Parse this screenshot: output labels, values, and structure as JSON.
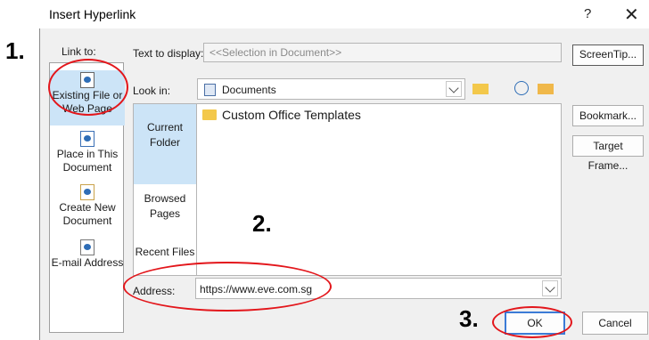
{
  "window": {
    "title": "Insert Hyperlink",
    "help": "?",
    "close": "✕"
  },
  "link_to": {
    "label": "Link to:",
    "items": [
      {
        "line1": "Existing File or",
        "line2": "Web Page",
        "selected": true
      },
      {
        "line1": "Place in This",
        "line2": "Document"
      },
      {
        "line1": "Create New",
        "line2": "Document"
      },
      {
        "line1": "E-mail Address",
        "line2": ""
      }
    ]
  },
  "text_to_display": {
    "label": "Text to display:",
    "value": "<<Selection in Document>>"
  },
  "screentip_label": "ScreenTip...",
  "look_in": {
    "label": "Look in:",
    "value": "Documents"
  },
  "side_nav": [
    {
      "line1": "Current",
      "line2": "Folder",
      "selected": true
    },
    {
      "line1": "Browsed",
      "line2": "Pages"
    },
    {
      "line1": "Recent Files",
      "line2": ""
    }
  ],
  "files": [
    {
      "name": "Custom Office Templates"
    }
  ],
  "right_buttons": {
    "bookmark": "Bookmark...",
    "target_frame": "Target Frame..."
  },
  "address": {
    "label": "Address:",
    "value": "https://www.eve.com.sg"
  },
  "buttons": {
    "ok": "OK",
    "cancel": "Cancel"
  },
  "callouts": {
    "one": "1.",
    "two": "2.",
    "three": "3."
  },
  "colors": {
    "annotation_red": "#e3161b",
    "selection": "#cce4f7",
    "primary_border": "#3b7bd6"
  }
}
